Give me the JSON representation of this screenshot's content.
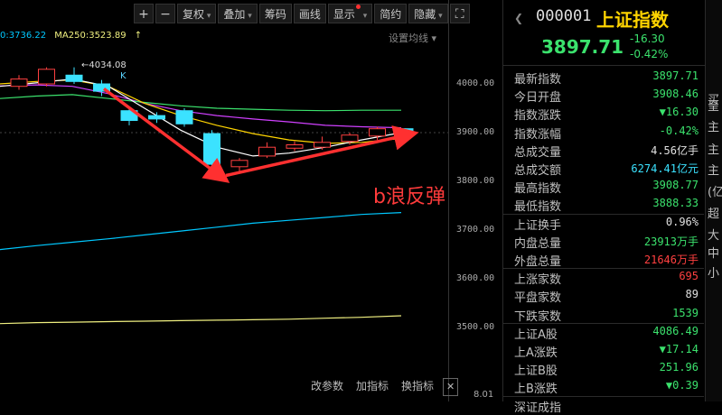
{
  "toolbar": {
    "items": [
      "+",
      "−",
      "复权",
      "叠加",
      "筹码",
      "画线",
      "显示",
      "简约",
      "隐藏",
      "⛶"
    ]
  },
  "ma": {
    "ma_text": "0:3736.22",
    "ma250_text": "MA250:3523.89",
    "settings": "设置均线"
  },
  "annotations": {
    "peak": "4034.08",
    "k": "K",
    "wave": "b浪反弹"
  },
  "axis": {
    "ticks": [
      "4000.00",
      "3900.00",
      "3800.00",
      "3700.00",
      "3600.00",
      "3500.00"
    ]
  },
  "bottom": {
    "buttons": [
      "改参数",
      "加指标",
      "换指标"
    ],
    "close_icon": "close-icon",
    "date": "8.01"
  },
  "colors": {
    "up": "#ff4040",
    "down": "#3be2ff",
    "ma5": "#ffffff",
    "ma10": "#ffd400",
    "ma20": "#d040ff",
    "ma30": "#3be26d",
    "ma60": "#00c8ff",
    "ma250": "#f0f080",
    "wave_arrow": "#ff3030"
  },
  "quote": {
    "code": "000001",
    "name": "上证指数",
    "price": "3897.71",
    "change": "-16.30",
    "pct": "-0.42%"
  },
  "rows": [
    {
      "label": "最新指数",
      "value": "3897.71",
      "cls": "g"
    },
    {
      "label": "今日开盘",
      "value": "3908.46",
      "cls": "g"
    },
    {
      "label": "指数涨跌",
      "value": "▼16.30",
      "cls": "g"
    },
    {
      "label": "指数涨幅",
      "value": "-0.42%",
      "cls": "g"
    },
    {
      "label": "总成交量",
      "value": "4.56亿手",
      "cls": "w"
    },
    {
      "label": "总成交额",
      "value": "6274.41亿元",
      "cls": "c"
    },
    {
      "label": "最高指数",
      "value": "3908.77",
      "cls": "g"
    },
    {
      "label": "最低指数",
      "value": "3888.33",
      "cls": "g"
    },
    {
      "label": "上证换手",
      "value": "0.96%",
      "cls": "w"
    },
    {
      "label": "内盘总量",
      "value": "23913万手",
      "cls": "g"
    },
    {
      "label": "外盘总量",
      "value": "21646万手",
      "cls": "r"
    },
    {
      "label": "上涨家数",
      "value": "695",
      "cls": "r"
    },
    {
      "label": "平盘家数",
      "value": "89",
      "cls": "w"
    },
    {
      "label": "下跌家数",
      "value": "1539",
      "cls": "g"
    },
    {
      "label": "上证A股",
      "value": "4086.49",
      "cls": "g"
    },
    {
      "label": "上A涨跌",
      "value": "▼17.14",
      "cls": "g"
    },
    {
      "label": "上证B股",
      "value": "251.96",
      "cls": "g"
    },
    {
      "label": "上B涨跌",
      "value": "▼0.39",
      "cls": "g"
    },
    {
      "label": "深证成指",
      "value": "",
      "cls": "w"
    }
  ],
  "strip": [
    "买",
    "呈",
    "主",
    "主",
    "主",
    "(亿",
    "超",
    "大",
    "中",
    "小"
  ],
  "chart_data": {
    "type": "candlestick",
    "ylim": [
      3450,
      4060
    ],
    "candles": [
      {
        "o": 3995,
        "c": 4010,
        "h": 4018,
        "l": 3988
      },
      {
        "o": 4000,
        "c": 4030,
        "h": 4034,
        "l": 3995
      },
      {
        "o": 4018,
        "c": 4005,
        "h": 4034,
        "l": 4000
      },
      {
        "o": 4000,
        "c": 3985,
        "h": 4008,
        "l": 3975
      },
      {
        "o": 3945,
        "c": 3925,
        "h": 3952,
        "l": 3915
      },
      {
        "o": 3935,
        "c": 3928,
        "h": 3942,
        "l": 3920
      },
      {
        "o": 3945,
        "c": 3918,
        "h": 3950,
        "l": 3912
      },
      {
        "o": 3898,
        "c": 3835,
        "h": 3905,
        "l": 3832
      },
      {
        "o": 3830,
        "c": 3843,
        "h": 3848,
        "l": 3820
      },
      {
        "o": 3852,
        "c": 3870,
        "h": 3880,
        "l": 3848
      },
      {
        "o": 3868,
        "c": 3875,
        "h": 3882,
        "l": 3862
      },
      {
        "o": 3870,
        "c": 3880,
        "h": 3892,
        "l": 3865
      },
      {
        "o": 3882,
        "c": 3895,
        "h": 3900,
        "l": 3875
      },
      {
        "o": 3893,
        "c": 3908,
        "h": 3912,
        "l": 3885
      },
      {
        "o": 3908,
        "c": 3898,
        "h": 3909,
        "l": 3888
      }
    ]
  }
}
